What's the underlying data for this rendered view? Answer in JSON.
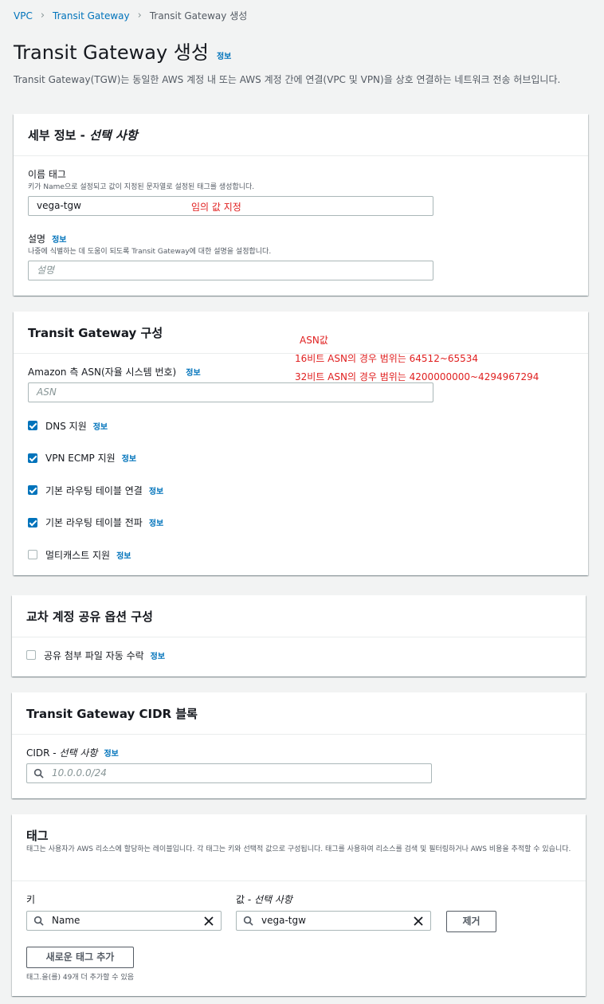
{
  "breadcrumb": {
    "items": [
      "VPC",
      "Transit Gateway"
    ],
    "current": "Transit Gateway 생성"
  },
  "page": {
    "title": "Transit Gateway 생성",
    "info_link": "정보",
    "description": "Transit Gateway(TGW)는 동일한 AWS 계정 내 또는 AWS 계정 간에 연결(VPC 및 VPN)을 상호 연결하는 네트워크 전송 허브입니다."
  },
  "details": {
    "title": "세부 정보 - ",
    "title_optional": "선택 사항",
    "name_tag_label": "이름 태그",
    "name_tag_hint": "키가 Name으로 설정되고 값이 지정된 문자열로 설정된 태그를 생성합니다.",
    "name_tag_value": "vega-tgw",
    "name_tag_annotation": "임의 값 지정",
    "desc_label": "설명",
    "desc_info": "정보",
    "desc_hint": "나중에 식별하는 데 도움이 되도록 Transit Gateway에 대한 설명을 설정합니다.",
    "desc_placeholder": "설명"
  },
  "config": {
    "title": "Transit Gateway 구성",
    "asn_label": "Amazon 측 ASN(자율 시스템 번호)",
    "asn_info": "정보",
    "asn_placeholder": "ASN",
    "annotation": [
      "ASN값",
      "16비트 ASN의 경우 범위는 64512~65534",
      "32비트 ASN의 경우 범위는 4200000000~4294967294"
    ],
    "options": [
      {
        "label": "DNS 지원",
        "info": "정보",
        "checked": true
      },
      {
        "label": "VPN ECMP 지원",
        "info": "정보",
        "checked": true
      },
      {
        "label": "기본 라우팅 테이블 연결",
        "info": "정보",
        "checked": true
      },
      {
        "label": "기본 라우팅 테이블 전파",
        "info": "정보",
        "checked": true
      },
      {
        "label": "멀티캐스트 지원",
        "info": "정보",
        "checked": false
      }
    ]
  },
  "sharing": {
    "title": "교차 계정 공유 옵션 구성",
    "option_label": "공유 첨부 파일 자동 수락",
    "option_info": "정보",
    "checked": false
  },
  "cidr": {
    "title": "Transit Gateway CIDR 블록",
    "label": "CIDR - ",
    "label_optional": "선택 사항",
    "info": "정보",
    "placeholder": "10.0.0.0/24"
  },
  "tags": {
    "title": "태그",
    "description": "태그는 사용자가 AWS 리소스에 할당하는 레이블입니다. 각 태그는 키와 선택적 값으로 구성됩니다. 태그를 사용하여 리소스를 검색 및 필터링하거나 AWS 비용을 추적할 수 있습니다.",
    "key_label": "키",
    "value_label": "값 - ",
    "value_optional": "선택 사항",
    "key_value": "Name",
    "value_value": "vega-tgw",
    "remove_button": "제거",
    "add_button": "새로운 태그 추가",
    "remaining": "태그.을(를) 49개 더 추가할 수 있음"
  },
  "colors": {
    "accent": "#0073bb",
    "annotation": "#e02020",
    "bg": "#f2f3f3"
  }
}
